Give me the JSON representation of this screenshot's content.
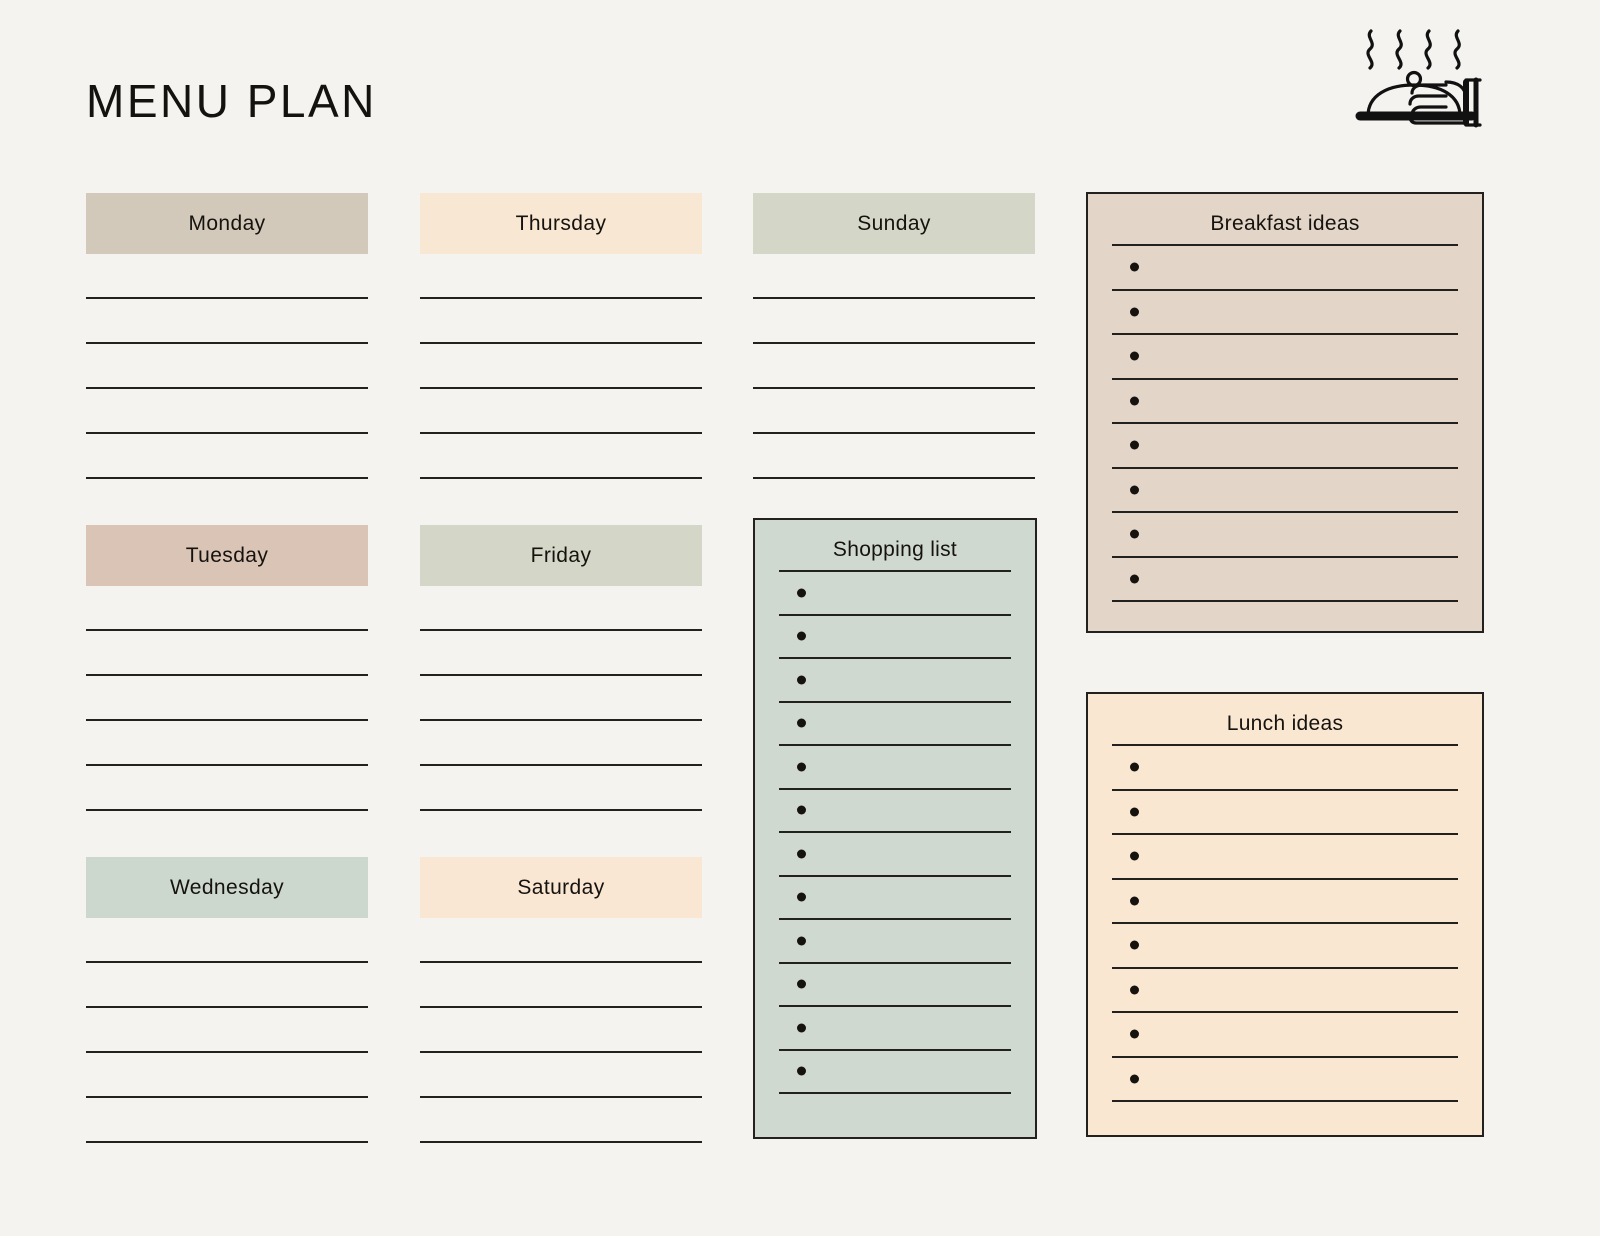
{
  "page": {
    "title": "MENU PLAN",
    "background_color": "#f4f3f0",
    "ink_color": "#23211e"
  },
  "header_icon": {
    "name": "serving-tray-icon",
    "description": "covered serving tray with steam and hand"
  },
  "days": [
    {
      "label": "Monday",
      "color": "#d2c9ba",
      "lines": 5,
      "column": 1,
      "row": 1
    },
    {
      "label": "Tuesday",
      "color": "#d9c4b6",
      "lines": 5,
      "column": 1,
      "row": 2
    },
    {
      "label": "Wednesday",
      "color": "#ccd7cd",
      "lines": 5,
      "column": 1,
      "row": 3
    },
    {
      "label": "Thursday",
      "color": "#f8e7d3",
      "lines": 5,
      "column": 2,
      "row": 1
    },
    {
      "label": "Friday",
      "color": "#d4d6c7",
      "lines": 5,
      "column": 2,
      "row": 2
    },
    {
      "label": "Saturday",
      "color": "#f9e7d4",
      "lines": 5,
      "column": 2,
      "row": 3
    },
    {
      "label": "Sunday",
      "color": "#d4d6c7",
      "lines": 5,
      "column": 3,
      "row": 1
    }
  ],
  "panels": {
    "shopping_list": {
      "title": "Shopping list",
      "background_color": "#cfd9cf",
      "border_color": "#23211e",
      "bullet_rows": 12,
      "items": [
        "",
        "",
        "",
        "",
        "",
        "",
        "",
        "",
        "",
        "",
        "",
        ""
      ]
    },
    "breakfast_ideas": {
      "title": "Breakfast ideas",
      "background_color": "#e4d5c9",
      "border_color": "#23211e",
      "bullet_rows": 8,
      "items": [
        "",
        "",
        "",
        "",
        "",
        "",
        "",
        ""
      ]
    },
    "lunch_ideas": {
      "title": "Lunch ideas",
      "background_color": "#fae7d2",
      "border_color": "#23211e",
      "bullet_rows": 8,
      "items": [
        "",
        "",
        "",
        "",
        "",
        "",
        "",
        ""
      ]
    }
  }
}
